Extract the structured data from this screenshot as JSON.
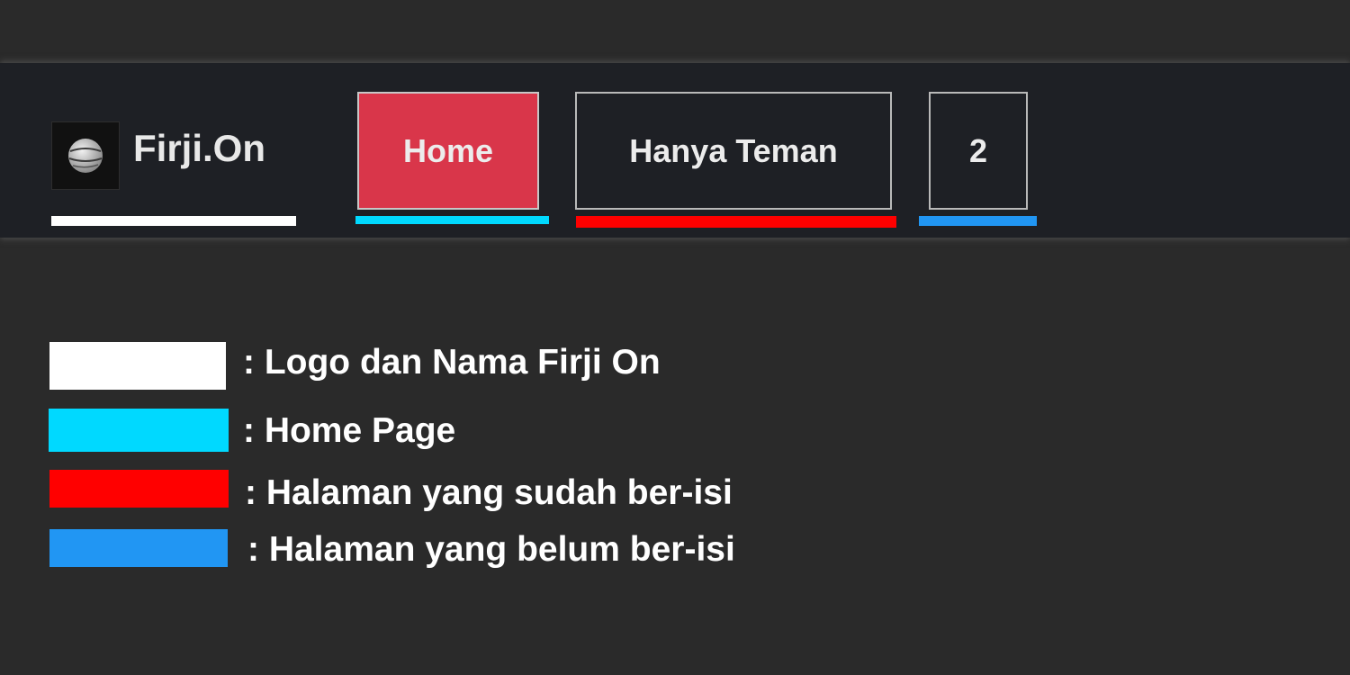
{
  "navbar": {
    "brand_name": "Firji.On",
    "logo_icon": "globe-icon",
    "items": [
      {
        "label": "Home",
        "active": true
      },
      {
        "label": "Hanya Teman",
        "active": false
      },
      {
        "label": "2",
        "active": false
      }
    ]
  },
  "colors": {
    "navbar_bg": "#1e2025",
    "page_bg": "#2a2a2a",
    "active_item_bg": "#d9364a",
    "logo_marker": "#ffffff",
    "home_marker": "#00d9ff",
    "filled_marker": "#ff0000",
    "empty_marker": "#2196f3"
  },
  "legend": {
    "items": [
      {
        "text": ": Logo dan Nama Firji On",
        "color": "#ffffff"
      },
      {
        "text": ": Home Page",
        "color": "#00d9ff"
      },
      {
        "text": ": Halaman yang sudah ber-isi",
        "color": "#ff0000"
      },
      {
        "text": ": Halaman yang belum ber-isi",
        "color": "#2196f3"
      }
    ]
  }
}
